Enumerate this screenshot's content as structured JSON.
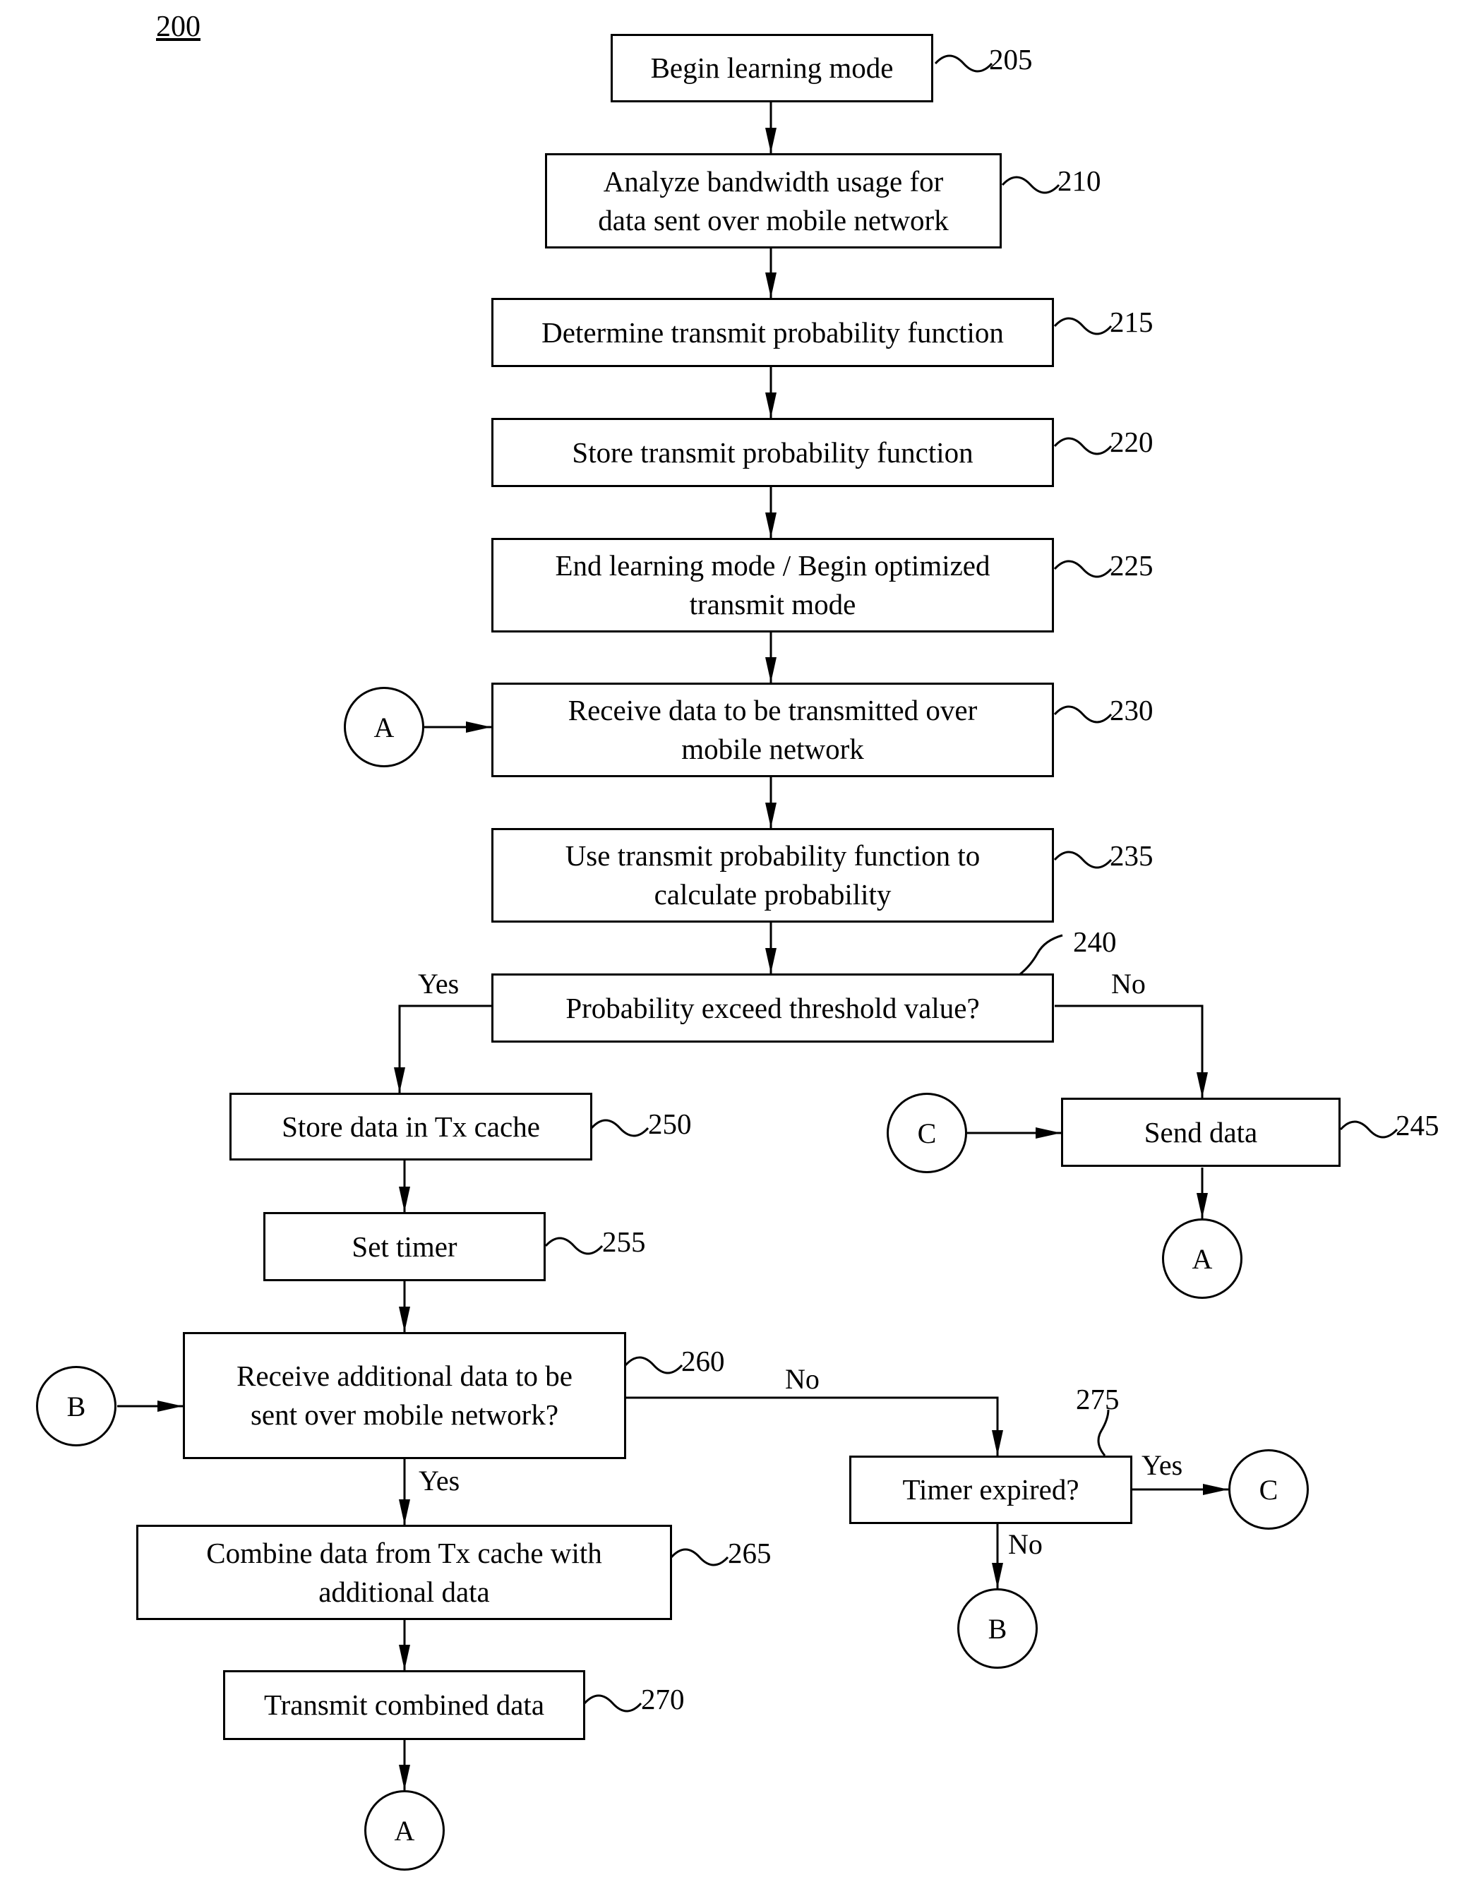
{
  "figure": {
    "number": "200"
  },
  "steps": [
    {
      "ref": "205",
      "text": "Begin learning mode"
    },
    {
      "ref": "210",
      "text": "Analyze bandwidth usage for\ndata sent over mobile network"
    },
    {
      "ref": "215",
      "text": "Determine transmit probability function"
    },
    {
      "ref": "220",
      "text": "Store transmit probability function"
    },
    {
      "ref": "225",
      "text": "End learning mode / Begin optimized\ntransmit mode"
    },
    {
      "ref": "230",
      "text": "Receive data to be transmitted over\nmobile network"
    },
    {
      "ref": "235",
      "text": "Use transmit probability function to\ncalculate probability"
    },
    {
      "ref": "240",
      "text": "Probability exceed threshold value?"
    },
    {
      "ref": "245",
      "text": "Send data"
    },
    {
      "ref": "250",
      "text": "Store data in Tx cache"
    },
    {
      "ref": "255",
      "text": "Set timer"
    },
    {
      "ref": "260",
      "text": "Receive additional data to be\nsent over mobile network?"
    },
    {
      "ref": "265",
      "text": "Combine data from Tx cache with\nadditional data"
    },
    {
      "ref": "270",
      "text": "Transmit combined data"
    },
    {
      "ref": "275",
      "text": "Timer expired?"
    }
  ],
  "connectors": {
    "a": "A",
    "b": "B",
    "c": "C"
  },
  "branch_labels": {
    "yes": "Yes",
    "no": "No"
  }
}
